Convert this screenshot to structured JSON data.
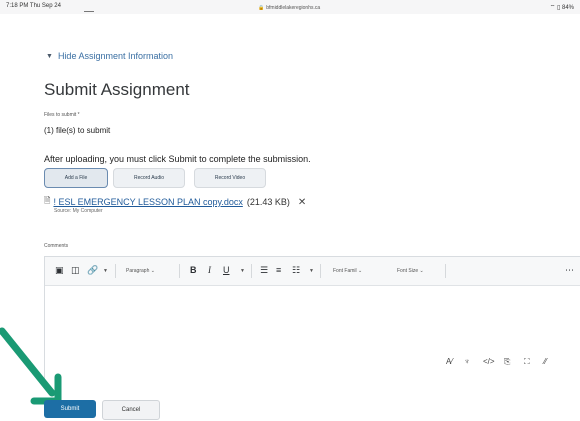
{
  "status_bar": {
    "time": "7:18 PM  Thu Sep 24",
    "url": "bfmiddlelakeregionhs.ca",
    "system": "⌔ ▯ 84%"
  },
  "assignment": {
    "hide_info_label": "Hide Assignment Information",
    "title": "Submit Assignment",
    "files_label": "Files to submit *",
    "files_count": "(1) file(s) to submit",
    "instruction": "After uploading, you must click Submit to complete the submission."
  },
  "upload_buttons": {
    "add_file": "Add a File",
    "record_audio": "Record Audio",
    "record_video": "Record Video"
  },
  "file": {
    "name": "! ESL EMERGENCY LESSON PLAN copy.docx",
    "size": "(21.43 KB)",
    "source": "Source: My Computer"
  },
  "comments": {
    "label": "Comments",
    "toolbar": {
      "paragraph": "Paragraph",
      "font_family": "Font Famil",
      "font_size": "Font Size"
    }
  },
  "actions": {
    "submit": "Submit",
    "cancel": "Cancel"
  },
  "colors": {
    "accent": "#1d6ea5",
    "link": "#1f5a9a",
    "arrow": "#1a9a74"
  },
  "icons": [
    "image-icon",
    "camera-icon",
    "link-icon",
    "bold-icon",
    "italic-icon",
    "underline-icon",
    "align-icon",
    "list-icon",
    "spellcheck-icon",
    "accessibility-icon",
    "source-code-icon",
    "preview-icon",
    "fullscreen-icon",
    "resize-icon",
    "more-icon"
  ]
}
